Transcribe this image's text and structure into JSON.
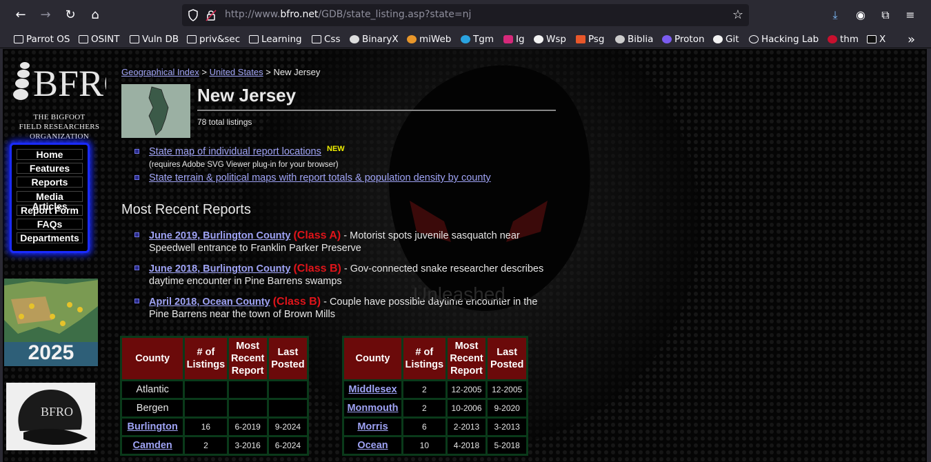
{
  "browser": {
    "url_prefix": "http://www.",
    "url_domain": "bfro.net",
    "url_path": "/GDB/state_listing.asp?state=nj",
    "bookmarks": [
      {
        "label": "Parrot OS",
        "icon": "folder-icon"
      },
      {
        "label": "OSINT",
        "icon": "folder-icon"
      },
      {
        "label": "Vuln DB",
        "icon": "folder-icon"
      },
      {
        "label": "priv&sec",
        "icon": "folder-icon"
      },
      {
        "label": "Learning",
        "icon": "folder-icon"
      },
      {
        "label": "Css",
        "icon": "folder-icon"
      },
      {
        "label": "BinaryX",
        "icon": "binaryx-icon"
      },
      {
        "label": "miWeb",
        "icon": "miweb-icon"
      },
      {
        "label": "Tgm",
        "icon": "telegram-icon"
      },
      {
        "label": "Ig",
        "icon": "instagram-icon"
      },
      {
        "label": "Wsp",
        "icon": "whatsapp-icon"
      },
      {
        "label": "Psg",
        "icon": "psg-icon"
      },
      {
        "label": "Biblia",
        "icon": "biblia-icon"
      },
      {
        "label": "Proton",
        "icon": "proton-icon"
      },
      {
        "label": "Git",
        "icon": "github-icon"
      },
      {
        "label": "Hacking Lab",
        "icon": "globe-icon"
      },
      {
        "label": "thm",
        "icon": "thm-icon"
      },
      {
        "label": "X",
        "icon": "x-icon"
      }
    ]
  },
  "sidebar": {
    "logo_text": "BFRO",
    "tagline_1": "The Bigfoot",
    "tagline_2": "Field Researchers",
    "tagline_3": "Organization",
    "menu": [
      "Home",
      "Features",
      "Reports",
      "Media Articles",
      "Report Form",
      "FAQs",
      "Departments"
    ],
    "map_ad_year": "2025",
    "hat_text": "BFRO"
  },
  "breadcrumb": {
    "geo_index": "Geographical Index",
    "sep1": " > ",
    "country": "United States",
    "sep2": " > ",
    "state": "New Jersey"
  },
  "header": {
    "state_name": "New Jersey",
    "total_listings": "78 total listings"
  },
  "links": {
    "state_map": "State map of individual report locations",
    "new_badge": "NEW",
    "svg_note": "(requires Adobe SVG Viewer plug-in for your browser)",
    "terrain_maps": "State terrain & political maps with report totals & population density by county"
  },
  "recent": {
    "heading": "Most Recent Reports",
    "reports": [
      {
        "link": "June 2019, Burlington County",
        "class": "(Class A)",
        "desc_1": "- Motorist spots juvenile sasquatch near",
        "desc_2": "Speedwell entrance to Franklin Parker Preserve"
      },
      {
        "link": "June 2018, Burlington County",
        "class": "(Class B)",
        "desc_1": "- Gov-connected snake researcher describes",
        "desc_2": "daytime encounter in Pine Barrens swamps"
      },
      {
        "link": "April 2018, Ocean County",
        "class": "(Class B)",
        "desc_1": "- Couple have possible daytime encounter in the",
        "desc_2": "Pine Barrens near the town of Brown Mills"
      }
    ]
  },
  "table_headers": {
    "county": "County",
    "listings_1": "# of",
    "listings_2": "Listings",
    "recent_1": "Most",
    "recent_2": "Recent",
    "recent_3": "Report",
    "last_1": "Last",
    "last_2": "Posted"
  },
  "table_left": [
    {
      "county": "Atlantic",
      "listings": "",
      "recent": "",
      "last": "",
      "linked": false
    },
    {
      "county": "Bergen",
      "listings": "",
      "recent": "",
      "last": "",
      "linked": false
    },
    {
      "county": "Burlington",
      "listings": "16",
      "recent": "6-2019",
      "last": "9-2024",
      "linked": true
    },
    {
      "county": "Camden",
      "listings": "2",
      "recent": "3-2016",
      "last": "6-2024",
      "linked": true
    }
  ],
  "table_right": [
    {
      "county": "Middlesex",
      "listings": "2",
      "recent": "12-2005",
      "last": "12-2005",
      "linked": true
    },
    {
      "county": "Monmouth",
      "listings": "2",
      "recent": "10-2006",
      "last": "9-2020",
      "linked": true
    },
    {
      "county": "Morris",
      "listings": "6",
      "recent": "2-2013",
      "last": "3-2013",
      "linked": true
    },
    {
      "county": "Ocean",
      "listings": "10",
      "recent": "4-2018",
      "last": "5-2018",
      "linked": true
    }
  ],
  "background_watermark": "Unleashed"
}
